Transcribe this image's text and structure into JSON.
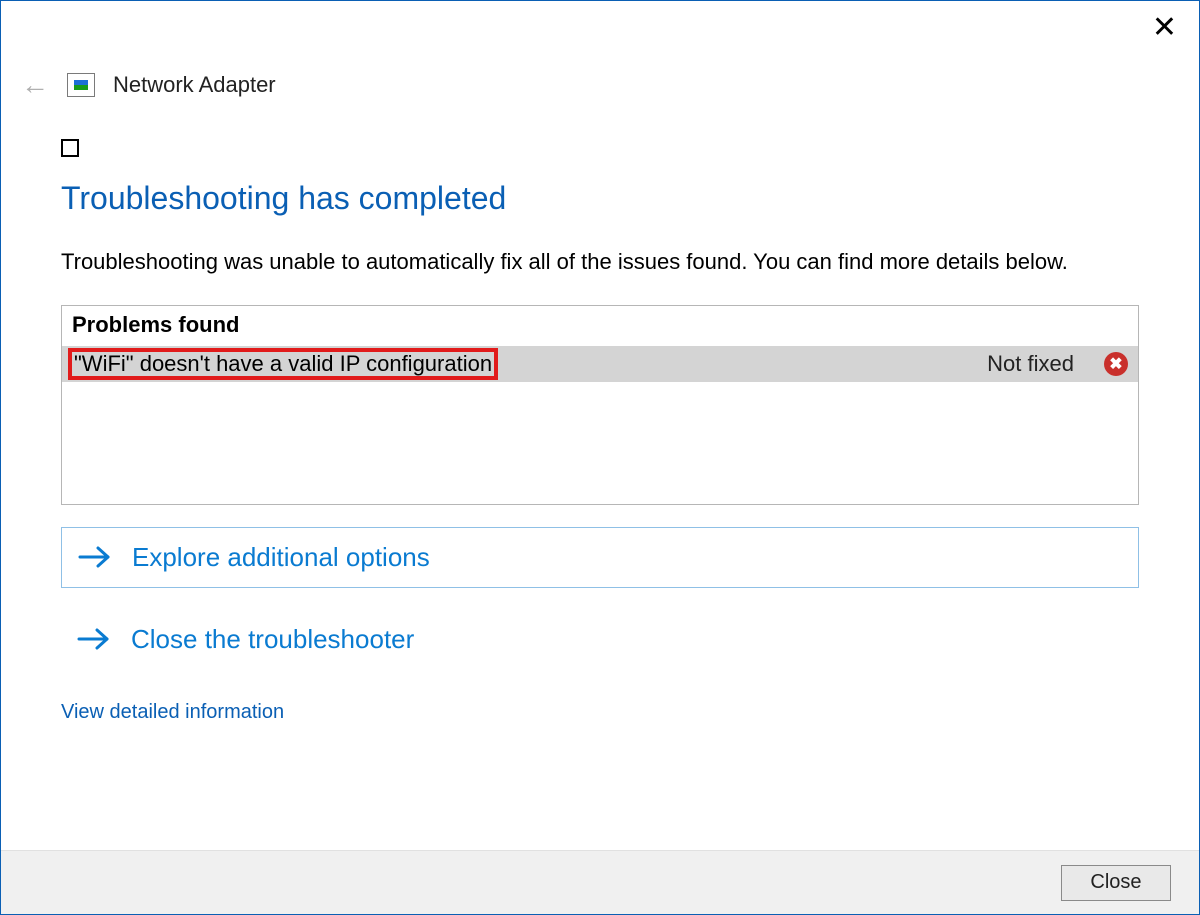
{
  "header": {
    "title": "Network Adapter"
  },
  "main": {
    "title": "Troubleshooting has completed",
    "description": "Troubleshooting was unable to automatically fix all of the issues found. You can find more details below."
  },
  "problems": {
    "header": "Problems found",
    "items": [
      {
        "name": "\"WiFi\" doesn't have a valid IP configuration",
        "status": "Not fixed"
      }
    ]
  },
  "options": {
    "explore": "Explore additional options",
    "close_troubleshooter": "Close the troubleshooter"
  },
  "links": {
    "detailed": "View detailed information"
  },
  "footer": {
    "close_label": "Close"
  }
}
